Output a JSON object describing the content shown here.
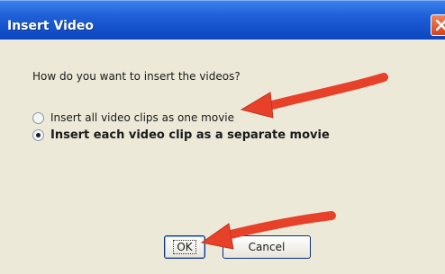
{
  "window": {
    "title": "Insert Video",
    "close_icon": "close-icon",
    "titlebar_color": "#1f5fd7",
    "client_color": "#ece9d8"
  },
  "dialog": {
    "prompt": "How do you want to insert the videos?",
    "options": [
      {
        "label": "Insert all video clips as one movie",
        "selected": false
      },
      {
        "label": "Insert each video clip as a separate movie",
        "selected": true
      }
    ]
  },
  "buttons": {
    "ok_label": "OK",
    "cancel_label": "Cancel"
  },
  "annotations": {
    "arrow_color": "#e8412a",
    "arrow_icon": "red-arrow-icon"
  }
}
